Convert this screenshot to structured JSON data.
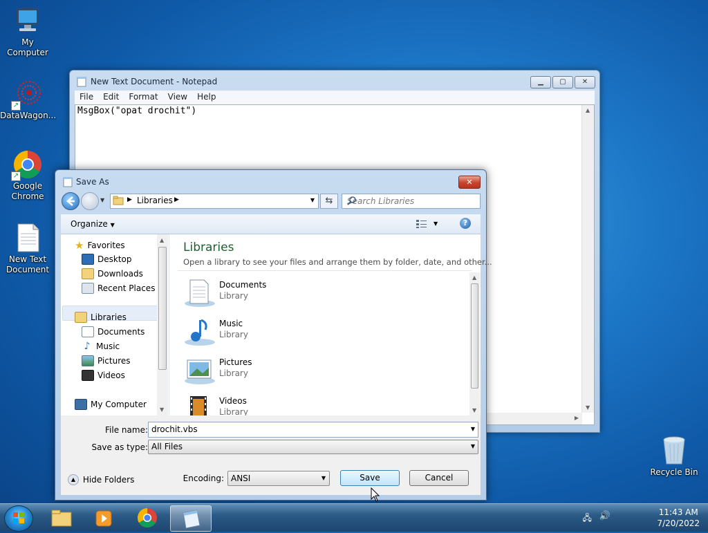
{
  "desktop": {
    "icons": [
      {
        "label": "My Computer",
        "icon": "computer-icon"
      },
      {
        "label": "DataWagon...",
        "icon": "datawagon-icon"
      },
      {
        "label": "Google Chrome",
        "icon": "chrome-icon"
      },
      {
        "label": "New Text Document",
        "icon": "text-document-icon"
      },
      {
        "label": "Recycle Bin",
        "icon": "recycle-bin-icon"
      }
    ]
  },
  "notepad": {
    "title": "New Text Document - Notepad",
    "menu": [
      "File",
      "Edit",
      "Format",
      "View",
      "Help"
    ],
    "content": "MsgBox(\"opat drochit\")"
  },
  "save_dialog": {
    "title": "Save As",
    "address": "Libraries",
    "search_placeholder": "Search Libraries",
    "organize_label": "Organize",
    "nav": {
      "favorites": "Favorites",
      "favorites_items": [
        "Desktop",
        "Downloads",
        "Recent Places"
      ],
      "libraries": "Libraries",
      "libraries_items": [
        "Documents",
        "Music",
        "Pictures",
        "Videos"
      ],
      "computer": "My Computer"
    },
    "content_heading": "Libraries",
    "content_subtitle": "Open a library to see your files and arrange them by folder, date, and other...",
    "items": [
      {
        "name": "Documents",
        "type": "Library"
      },
      {
        "name": "Music",
        "type": "Library"
      },
      {
        "name": "Pictures",
        "type": "Library"
      },
      {
        "name": "Videos",
        "type": "Library"
      }
    ],
    "file_name_label": "File name:",
    "file_name_value": "drochit.vbs",
    "save_type_label": "Save as type:",
    "save_type_value": "All Files",
    "hide_folders_label": "Hide Folders",
    "encoding_label": "Encoding:",
    "encoding_value": "ANSI",
    "save_button": "Save",
    "cancel_button": "Cancel"
  },
  "taskbar": {
    "time": "11:43 AM",
    "date": "7/20/2022"
  }
}
